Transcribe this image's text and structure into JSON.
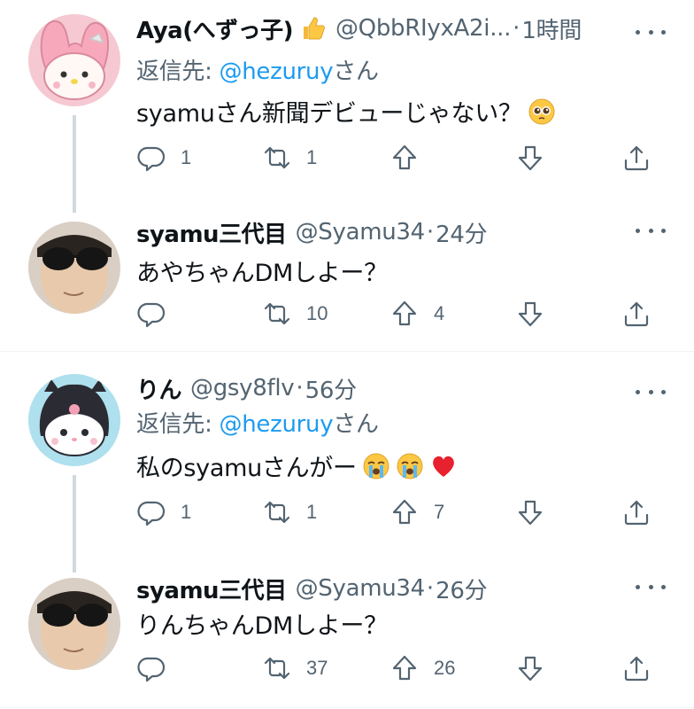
{
  "tweets": [
    {
      "name": "Aya(へずっ子)",
      "handle": "@QbbRIyxA2i...",
      "dot": "·",
      "time": "1時間",
      "reply_prefix": "返信先: ",
      "reply_mention": "@hezuruy",
      "reply_suffix": "さん",
      "text": "syamuさん新聞デビューじゃない？",
      "counts": {
        "reply": "1",
        "retweet": "1",
        "upvote": "",
        "downvote": ""
      }
    },
    {
      "name": "syamu三代目",
      "handle": "@Syamu34",
      "dot": "·",
      "time": "24分",
      "text": "あやちゃんDMしよー？",
      "counts": {
        "reply": "",
        "retweet": "10",
        "upvote": "4",
        "downvote": ""
      }
    },
    {
      "name": "りん",
      "handle": "@gsy8flv",
      "dot": "·",
      "time": "56分",
      "reply_prefix": "返信先: ",
      "reply_mention": "@hezuruy",
      "reply_suffix": "さん",
      "text": "私のsyamuさんがー",
      "counts": {
        "reply": "1",
        "retweet": "1",
        "upvote": "7",
        "downvote": ""
      }
    },
    {
      "name": "syamu三代目",
      "handle": "@Syamu34",
      "dot": "·",
      "time": "26分",
      "text": "りんちゃんDMしよー？",
      "counts": {
        "reply": "",
        "retweet": "37",
        "upvote": "26",
        "downvote": ""
      }
    }
  ],
  "icons": {
    "reply": "reply-icon",
    "retweet": "retweet-icon",
    "upvote": "upvote-icon",
    "downvote": "downvote-icon",
    "share": "share-icon",
    "more": "more-icon"
  },
  "colors": {
    "link": "#1d9bf0",
    "secondary": "#536471",
    "text": "#0f1419",
    "thread_line": "#cfd9de"
  }
}
